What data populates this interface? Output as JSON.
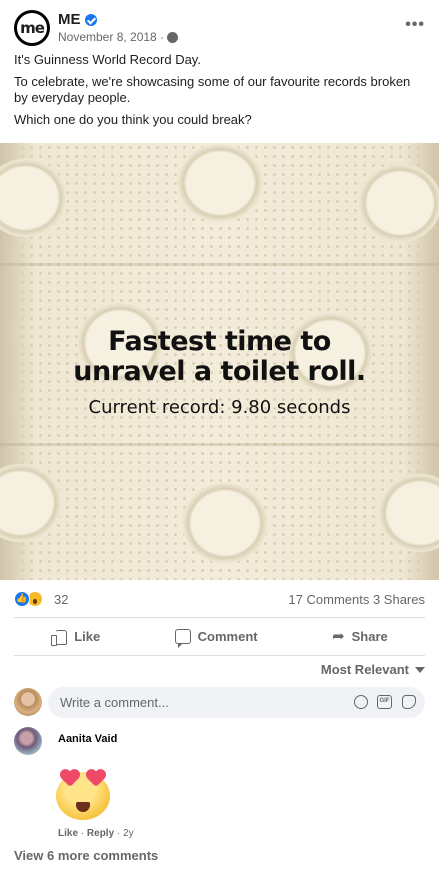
{
  "post": {
    "page_name": "ME",
    "avatar_text": "me",
    "date": "November 8, 2018 ·",
    "more_label": "•••",
    "text": [
      "It's Guinness World Record Day.",
      "To celebrate, we're showcasing some of our favourite records broken by everyday people.",
      "Which one do you think you could break?"
    ]
  },
  "photo": {
    "headline_line1": "Fastest time to",
    "headline_line2": "unravel a toilet roll.",
    "subline": "Current record: 9.80 seconds"
  },
  "stats": {
    "reactions_count": "32",
    "comments_shares": "17 Comments  3 Shares"
  },
  "actions": {
    "like": "Like",
    "comment": "Comment",
    "share": "Share"
  },
  "sort": {
    "label": "Most Relevant"
  },
  "composer": {
    "placeholder": "Write a comment..."
  },
  "comments": [
    {
      "author": "Aanita Vaid",
      "like": "Like",
      "reply": "Reply",
      "time": "2y"
    }
  ],
  "view_more": "View 6 more comments",
  "colors": {
    "accent": "#1877f2",
    "muted": "#65676b"
  }
}
